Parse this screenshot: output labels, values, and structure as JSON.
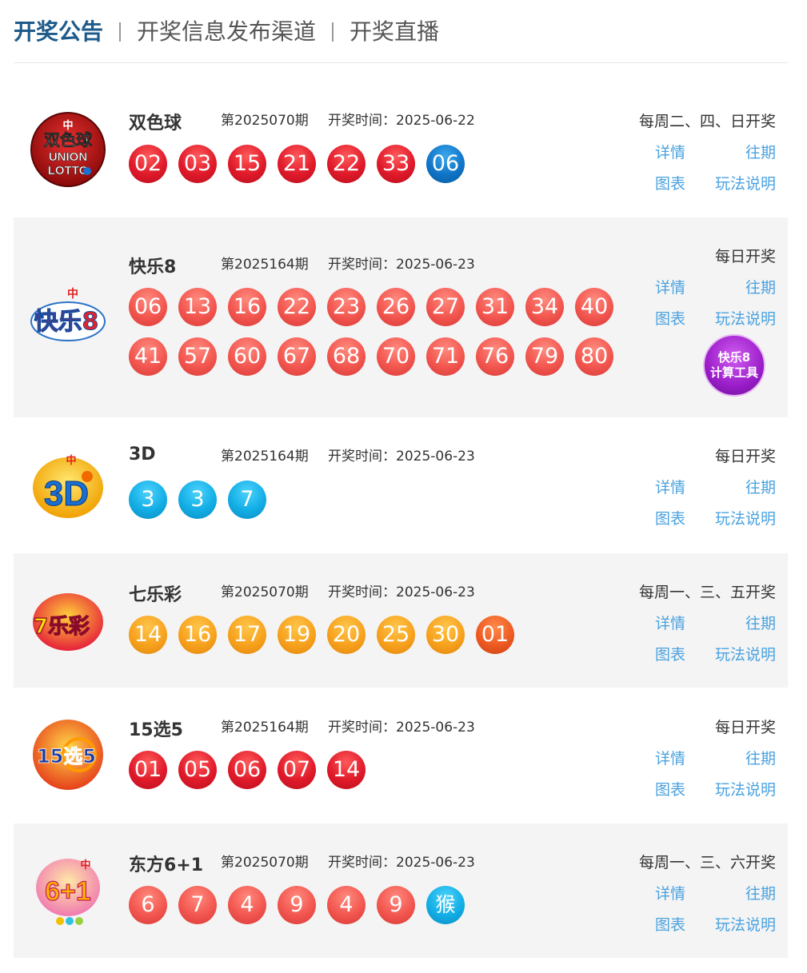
{
  "tabs": [
    "开奖公告",
    "开奖信息发布渠道",
    "开奖直播"
  ],
  "links": {
    "detail": "详情",
    "history": "往期",
    "chart": "图表",
    "rules": "玩法说明"
  },
  "games": [
    {
      "name": "双色球",
      "issue": "第2025070期",
      "draw_time": "开奖时间：2025-06-22",
      "schedule": "每周二、四、日开奖",
      "logo_text": [
        "双色球",
        "UNION",
        "LOTTO"
      ],
      "balls_row1": [
        "02",
        "03",
        "15",
        "21",
        "22",
        "33",
        "06"
      ],
      "ball_colors_row1": [
        "red",
        "red",
        "red",
        "red",
        "red",
        "red",
        "blue"
      ]
    },
    {
      "name": "快乐8",
      "issue": "第2025164期",
      "draw_time": "开奖时间：2025-06-23",
      "schedule": "每日开奖",
      "logo_text": [
        "快乐8"
      ],
      "balls_row1": [
        "06",
        "13",
        "16",
        "22",
        "23",
        "26",
        "27",
        "31",
        "34",
        "40"
      ],
      "balls_row2": [
        "41",
        "57",
        "60",
        "67",
        "68",
        "70",
        "71",
        "76",
        "79",
        "80"
      ],
      "tool_label": [
        "快乐8",
        "计算工具"
      ]
    },
    {
      "name": "3D",
      "issue": "第2025164期",
      "draw_time": "开奖时间：2025-06-23",
      "schedule": "每日开奖",
      "logo_text": [
        "3D"
      ],
      "balls_row1": [
        "3",
        "3",
        "7"
      ]
    },
    {
      "name": "七乐彩",
      "issue": "第2025070期",
      "draw_time": "开奖时间：2025-06-23",
      "schedule": "每周一、三、五开奖",
      "logo_text": [
        "7乐彩"
      ],
      "balls_row1": [
        "14",
        "16",
        "17",
        "19",
        "20",
        "25",
        "30",
        "01"
      ],
      "ball_colors_row1": [
        "orange",
        "orange",
        "orange",
        "orange",
        "orange",
        "orange",
        "orange",
        "deep"
      ]
    },
    {
      "name": "15选5",
      "issue": "第2025164期",
      "draw_time": "开奖时间：2025-06-23",
      "schedule": "每日开奖",
      "logo_text": [
        "15选5"
      ],
      "balls_row1": [
        "01",
        "05",
        "06",
        "07",
        "14"
      ]
    },
    {
      "name": "东方6+1",
      "issue": "第2025070期",
      "draw_time": "开奖时间：2025-06-23",
      "schedule": "每周一、三、六开奖",
      "logo_text": [
        "6+1"
      ],
      "balls_row1": [
        "6",
        "7",
        "4",
        "9",
        "4",
        "9",
        "猴"
      ],
      "ball_colors_row1": [
        "coral",
        "coral",
        "coral",
        "coral",
        "coral",
        "coral",
        "cyan"
      ]
    }
  ],
  "colors": {
    "brand_blue": "#1d5a8a",
    "link_blue": "#4aa2e0",
    "red_ball": "#e01a2a",
    "blue_ball": "#1075c8"
  }
}
